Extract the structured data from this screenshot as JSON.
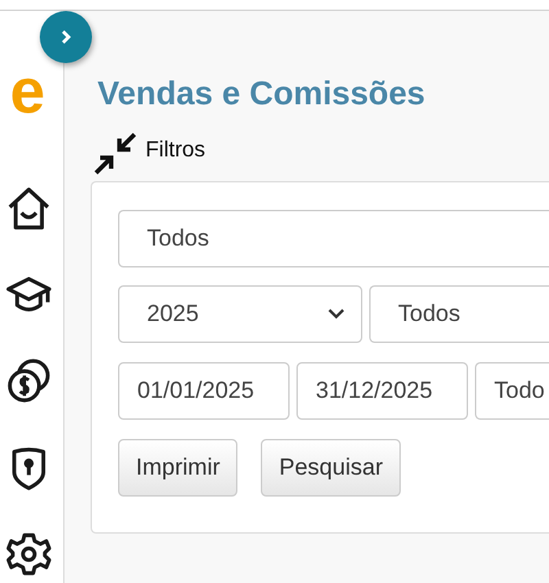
{
  "logo": "e",
  "sidebar": {
    "items": [
      {
        "kind": "home"
      },
      {
        "kind": "education"
      },
      {
        "kind": "coins"
      },
      {
        "kind": "security"
      },
      {
        "kind": "settings"
      }
    ]
  },
  "page": {
    "title": "Vendas e Comissões"
  },
  "filters": {
    "label": "Filtros",
    "rows": [
      [
        {
          "kind": "text",
          "value": "Todos"
        }
      ],
      [
        {
          "kind": "dropdown",
          "value": "2025"
        },
        {
          "kind": "text",
          "value": "Todos"
        }
      ],
      [
        {
          "kind": "text",
          "value": "01/01/2025"
        },
        {
          "kind": "text",
          "value": "31/12/2025"
        },
        {
          "kind": "text",
          "value": "Todo"
        }
      ]
    ],
    "buttons": [
      "Imprimir",
      "Pesquisar"
    ]
  }
}
